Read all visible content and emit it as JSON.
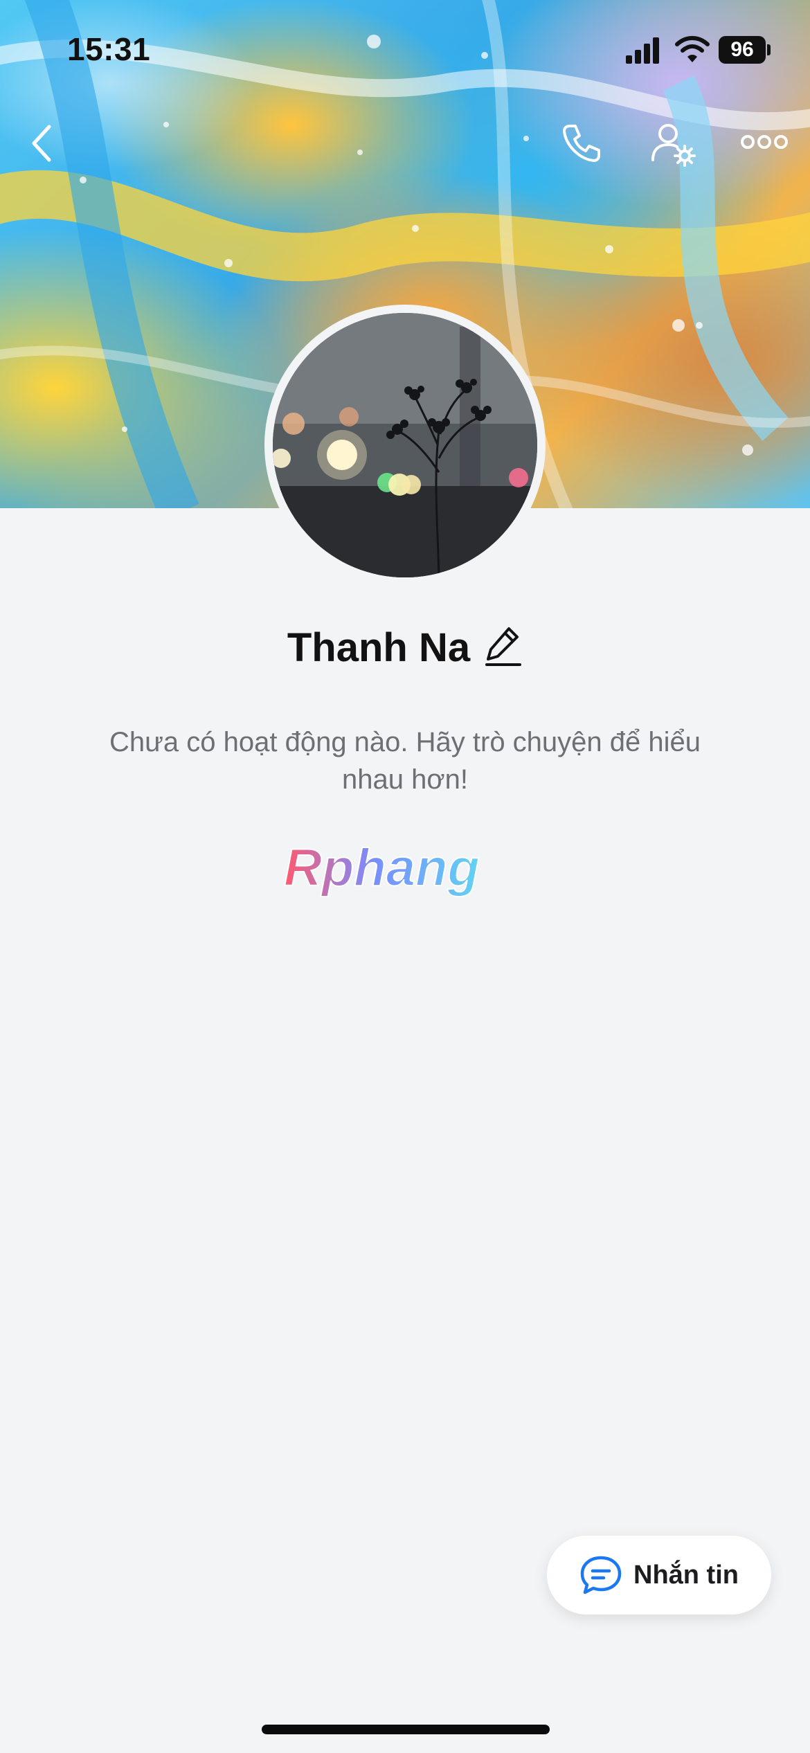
{
  "status_bar": {
    "time": "15:31",
    "battery": "96",
    "icons": [
      "cellular-signal-icon",
      "wifi-icon",
      "battery-icon"
    ]
  },
  "top_nav": {
    "icons": [
      "chevron-left-icon",
      "phone-icon",
      "user-settings-icon",
      "more-icon"
    ]
  },
  "profile": {
    "name": "Thanh Na",
    "edit_icon": "pencil-icon",
    "empty_message": "Chưa có hoạt động nào. Hãy trò chuyện để hiểu nhau hơn!"
  },
  "watermark": {
    "text": "Rphang"
  },
  "message_button": {
    "label": "Nhắn tin",
    "icon": "chat-bubble-icon",
    "accent": "#1b78f2"
  }
}
